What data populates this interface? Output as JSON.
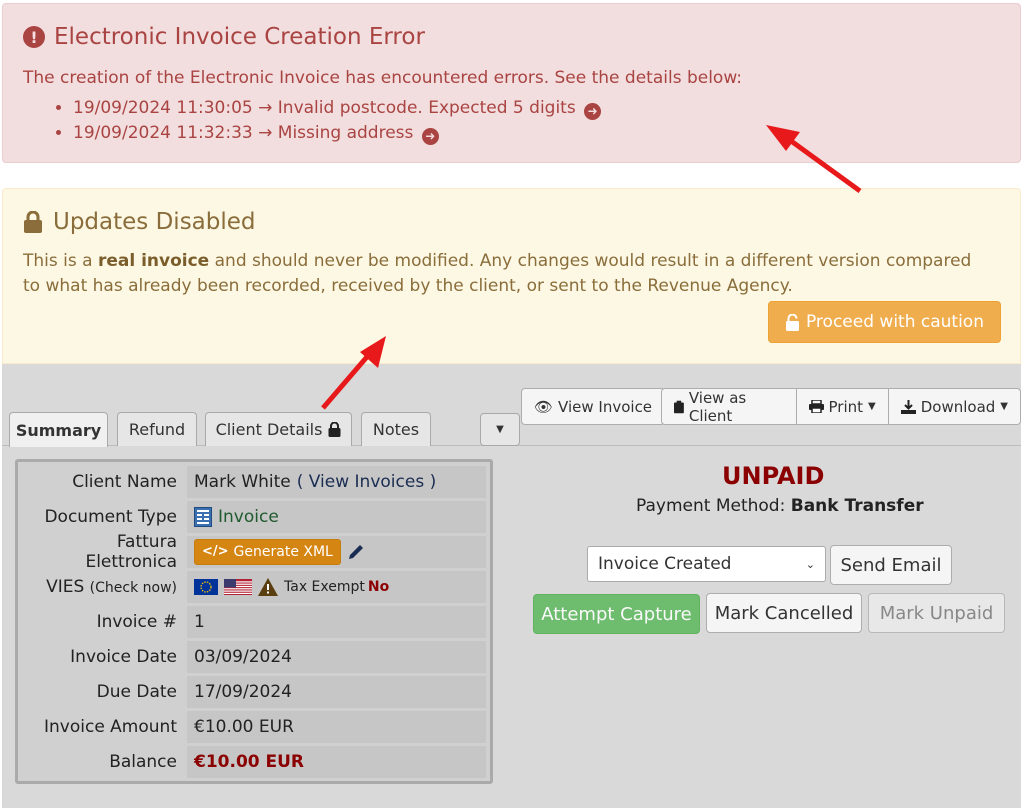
{
  "error_alert": {
    "title": "Electronic Invoice Creation Error",
    "message": "The creation of the Electronic Invoice has encountered errors. See the details below:",
    "items": [
      "19/09/2024 11:30:05 → Invalid postcode. Expected 5 digits",
      "19/09/2024 11:32:33 → Missing address"
    ]
  },
  "warning_alert": {
    "title": "Updates Disabled",
    "text_before": "This is a ",
    "text_bold": "real invoice",
    "text_after": " and should never be modified. Any changes would result in a different version compared to what has already been recorded, received by the client, or sent to the Revenue Agency.",
    "button": "Proceed with caution"
  },
  "tabs": [
    "Summary",
    "Refund",
    "Client Details",
    "Notes"
  ],
  "toolbar": {
    "view_invoice": "View Invoice",
    "view_as_client": "View as Client",
    "print": "Print",
    "download": "Download"
  },
  "summary": {
    "client_name_label": "Client Name",
    "client_name": "Mark White",
    "view_invoices_link": "( View Invoices )",
    "document_type_label": "Document Type",
    "document_type": "Invoice",
    "fattura_label": "Fattura Elettronica",
    "generate_xml": "Generate XML",
    "vies_label": "VIES",
    "check_now": "(Check now)",
    "tax_exempt_label": "Tax Exempt",
    "tax_exempt_value": "No",
    "invoice_num_label": "Invoice #",
    "invoice_num": "1",
    "invoice_date_label": "Invoice Date",
    "invoice_date": "03/09/2024",
    "due_date_label": "Due Date",
    "due_date": "17/09/2024",
    "amount_label": "Invoice Amount",
    "amount": "€10.00 EUR",
    "balance_label": "Balance",
    "balance": "€10.00 EUR"
  },
  "status_panel": {
    "status": "UNPAID",
    "payment_method_label": "Payment Method:",
    "payment_method": "Bank Transfer",
    "select_value": "Invoice Created",
    "send_email": "Send Email",
    "attempt_capture": "Attempt Capture",
    "mark_cancelled": "Mark Cancelled",
    "mark_unpaid": "Mark Unpaid"
  },
  "colors": {
    "error": "#a94442",
    "warning": "#8a6d3b",
    "caution_button": "#f0ad4e",
    "unpaid": "#8b0000",
    "annotation_arrow": "#e8191b"
  }
}
